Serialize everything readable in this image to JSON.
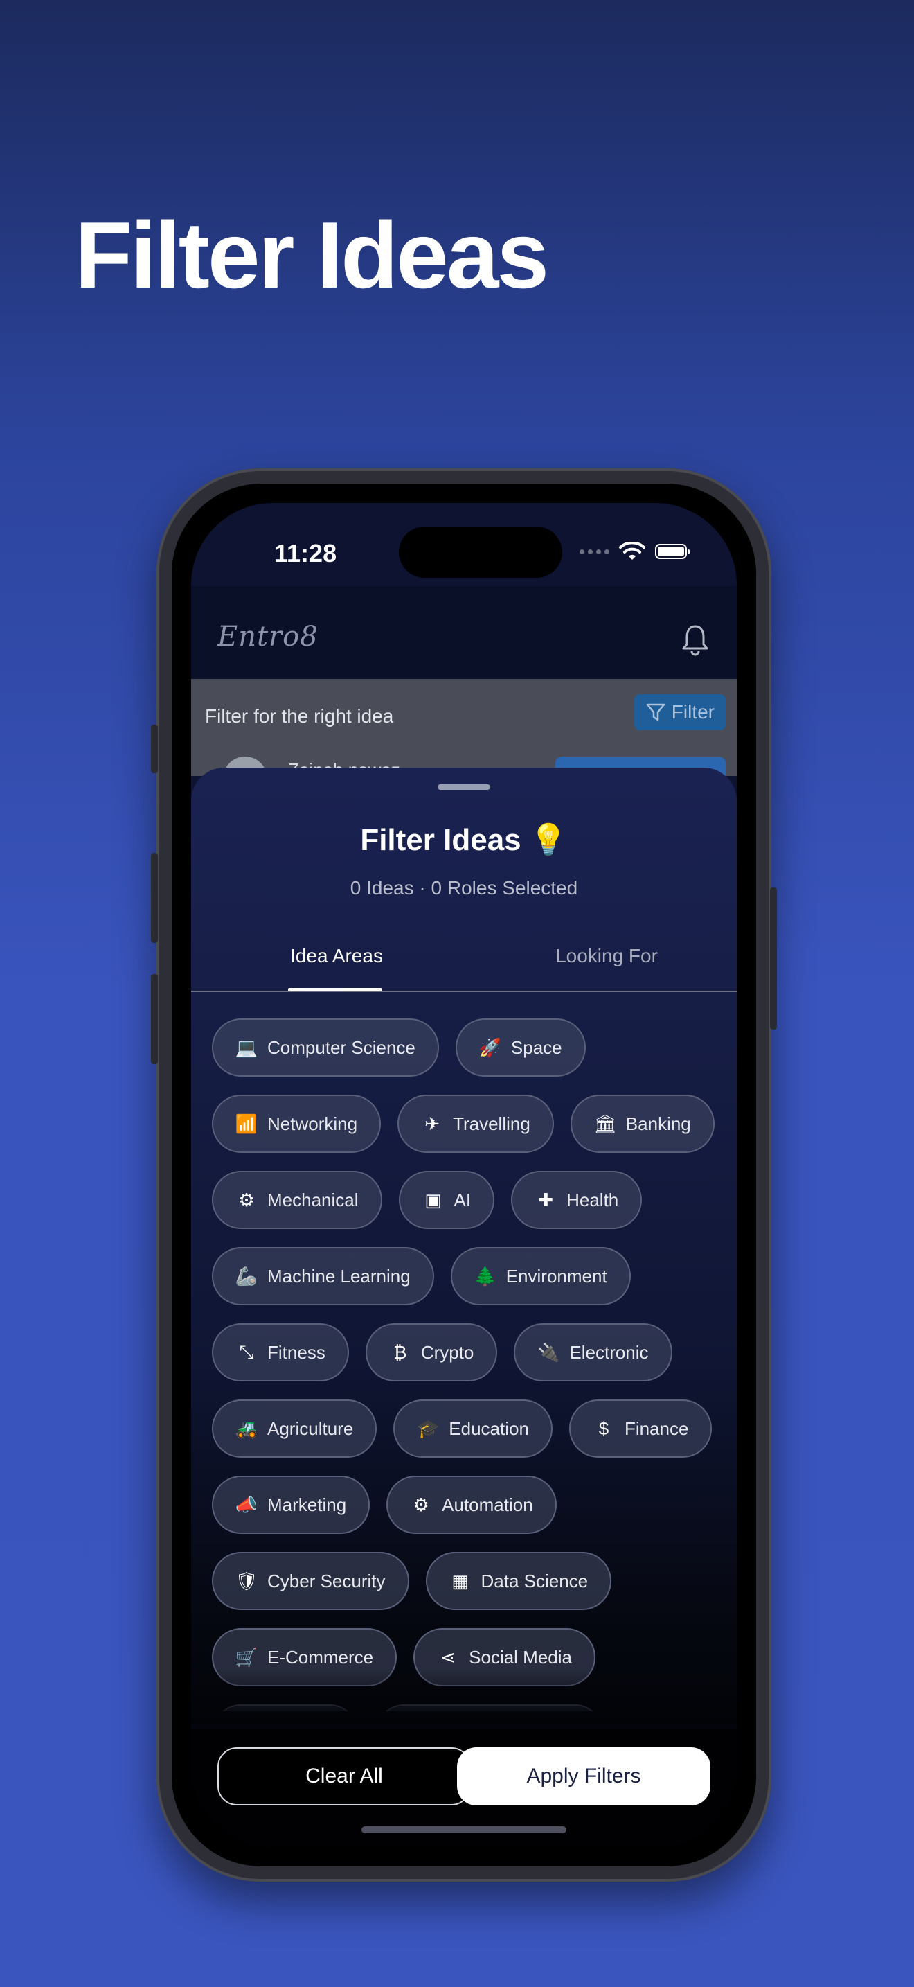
{
  "headline": "Filter Ideas",
  "status": {
    "time": "11:28"
  },
  "app": {
    "logo": "Entro8",
    "bell_icon": "bell-icon"
  },
  "behind": {
    "filter_prompt": "Filter for the right idea",
    "filter_button": "Filter",
    "user_name": "Zainab nawaz"
  },
  "sheet": {
    "title": "Filter Ideas 💡",
    "subtitle": "0 Ideas · 0 Roles Selected",
    "tabs": [
      {
        "label": "Idea Areas",
        "active": true
      },
      {
        "label": "Looking For",
        "active": false
      }
    ],
    "chip_rows": [
      [
        {
          "label": "Computer Science",
          "icon": "💻",
          "icon_name": "laptop-icon"
        },
        {
          "label": "Space",
          "icon": "🚀",
          "icon_name": "rocket-icon"
        }
      ],
      [
        {
          "label": "Networking",
          "icon": "📶",
          "icon_name": "wifi-icon"
        },
        {
          "label": "Travelling",
          "icon": "✈",
          "icon_name": "airplane-icon"
        },
        {
          "label": "Banking",
          "icon": "🏛",
          "icon_name": "bank-icon"
        }
      ],
      [
        {
          "label": "Mechanical",
          "icon": "⚙",
          "icon_name": "gear-icon"
        },
        {
          "label": "AI",
          "icon": "▣",
          "icon_name": "chip-icon"
        },
        {
          "label": "Health",
          "icon": "✚",
          "icon_name": "medical-plus-icon"
        }
      ],
      [
        {
          "label": "Machine Learning",
          "icon": "🦾",
          "icon_name": "robot-arm-icon"
        },
        {
          "label": "Environment",
          "icon": "🌲",
          "icon_name": "tree-icon"
        }
      ],
      [
        {
          "label": "Fitness",
          "icon": "⤡",
          "icon_name": "dumbbell-icon"
        },
        {
          "label": "Crypto",
          "icon": "₿",
          "icon_name": "bitcoin-icon"
        },
        {
          "label": "Electronic",
          "icon": "🔌",
          "icon_name": "plug-icon"
        }
      ],
      [
        {
          "label": "Agriculture",
          "icon": "🚜",
          "icon_name": "tractor-icon"
        },
        {
          "label": "Education",
          "icon": "🎓",
          "icon_name": "graduation-cap-icon"
        },
        {
          "label": "Finance",
          "icon": "$",
          "icon_name": "dollar-icon"
        }
      ],
      [
        {
          "label": "Marketing",
          "icon": "📣",
          "icon_name": "megaphone-icon"
        },
        {
          "label": "Automation",
          "icon": "⚙",
          "icon_name": "auto-gear-icon"
        }
      ],
      [
        {
          "label": "Cyber Security",
          "icon": "🛡",
          "icon_name": "shield-icon"
        },
        {
          "label": "Data Science",
          "icon": "▦",
          "icon_name": "grid-icon"
        }
      ],
      [
        {
          "label": "E-Commerce",
          "icon": "🛒",
          "icon_name": "cart-icon"
        },
        {
          "label": "Social Media",
          "icon": "⋖",
          "icon_name": "share-icon"
        }
      ],
      [
        {
          "label": "",
          "icon": "",
          "icon_name": "partial-chip-icon"
        },
        {
          "label": "",
          "icon": "",
          "icon_name": "partial-chip-icon"
        }
      ]
    ],
    "clear_button": "Clear All",
    "apply_button": "Apply Filters"
  },
  "colors": {
    "background_top": "#1c2a5e",
    "background_bottom": "#3a55be",
    "accent_filter": "#1f5e99"
  }
}
